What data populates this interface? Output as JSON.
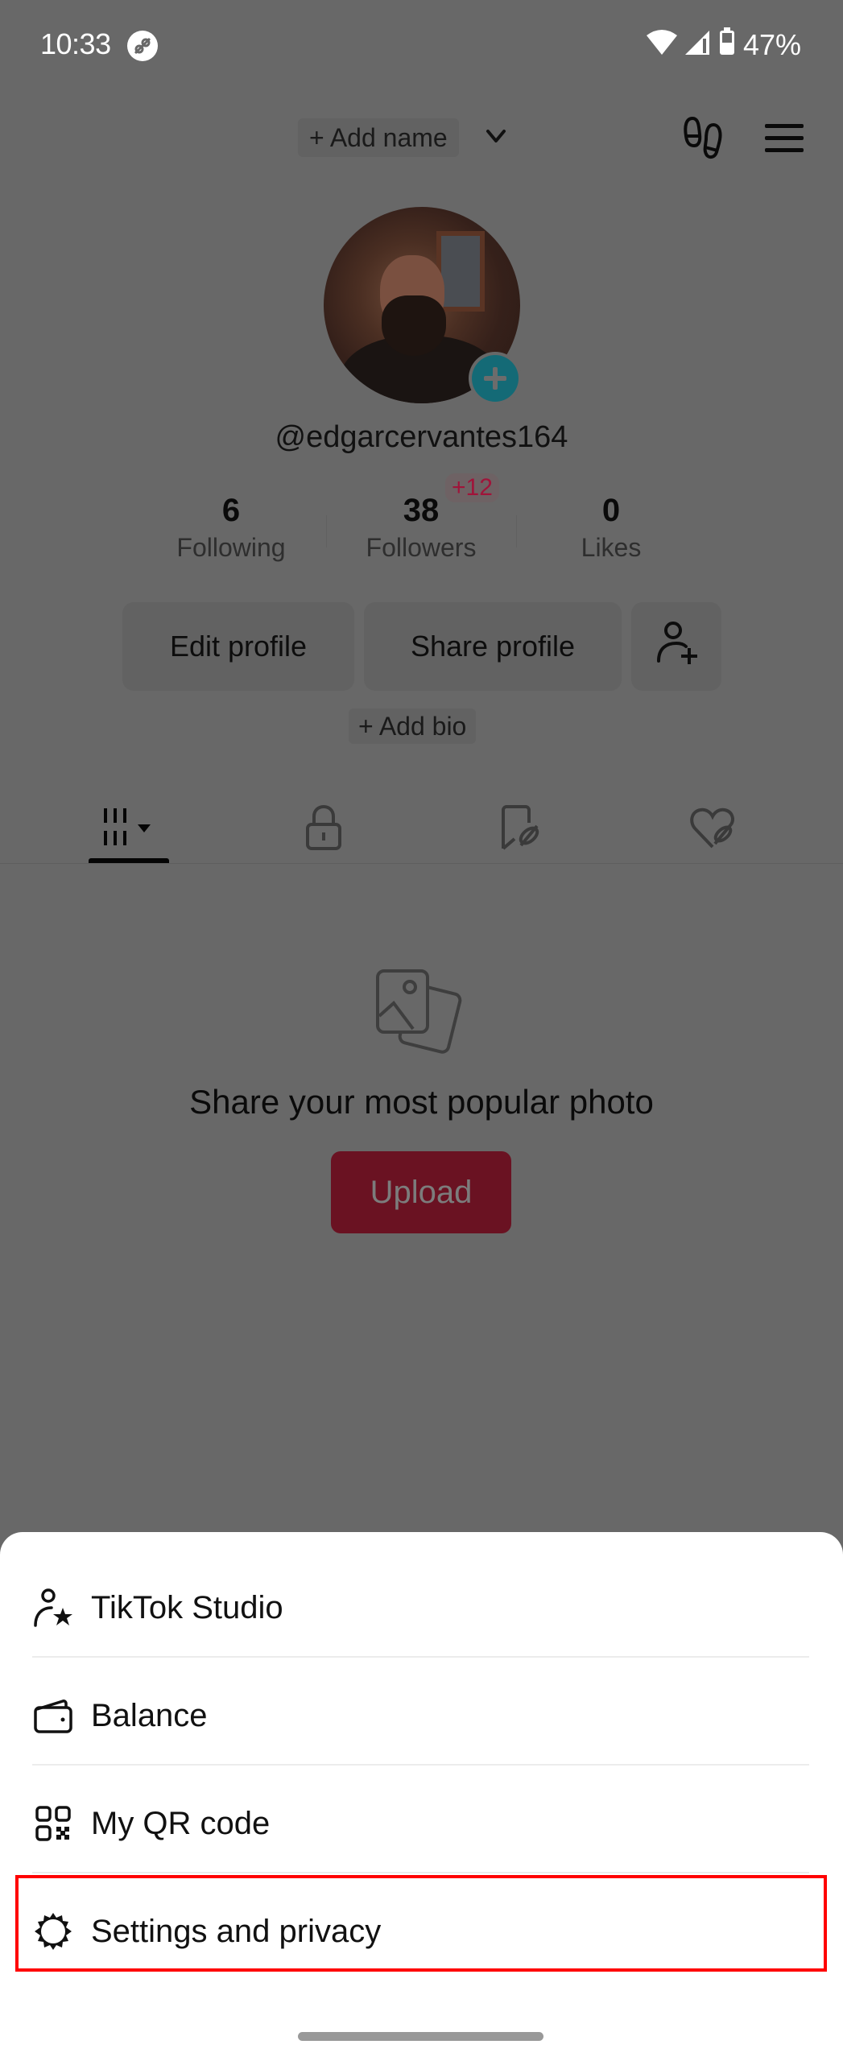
{
  "status_bar": {
    "time": "10:33",
    "app_icon": "link-app-icon",
    "battery": "47%",
    "icons": [
      "wifi-icon",
      "signal-icon",
      "battery-icon"
    ]
  },
  "header": {
    "add_name_label": "+ Add name",
    "icons": [
      "chevron-down-icon",
      "footprint-icon",
      "menu-icon"
    ]
  },
  "profile": {
    "username": "@edgarcervantes164",
    "avatar_badge_icon": "plus-icon",
    "stats": [
      {
        "value": "6",
        "label": "Following"
      },
      {
        "value": "38",
        "label": "Followers",
        "badge": "+12"
      },
      {
        "value": "0",
        "label": "Likes"
      }
    ],
    "buttons": {
      "edit": "Edit profile",
      "share": "Share profile",
      "add_friend_icon": "add-user-icon"
    },
    "add_bio_label": "+ Add bio"
  },
  "tabs": [
    {
      "name": "videos",
      "icon": "grid-icon",
      "active": true
    },
    {
      "name": "private",
      "icon": "lock-icon",
      "active": false
    },
    {
      "name": "saved",
      "icon": "bookmark-hidden-icon",
      "active": false
    },
    {
      "name": "liked",
      "icon": "heart-hidden-icon",
      "active": false
    }
  ],
  "empty_state": {
    "title": "Share your most popular photo",
    "button": "Upload"
  },
  "sheet": {
    "items": [
      {
        "label": "TikTok Studio",
        "icon": "creator-star-icon"
      },
      {
        "label": "Balance",
        "icon": "wallet-icon"
      },
      {
        "label": "My QR code",
        "icon": "qr-code-icon"
      },
      {
        "label": "Settings and privacy",
        "icon": "gear-icon",
        "highlighted": true
      }
    ]
  },
  "colors": {
    "scrim": "#686868",
    "accent_teal": "#146a76",
    "upload_red_dimmed": "#6a1222",
    "badge_red": "#a0143a",
    "highlight": "#ff0000"
  }
}
